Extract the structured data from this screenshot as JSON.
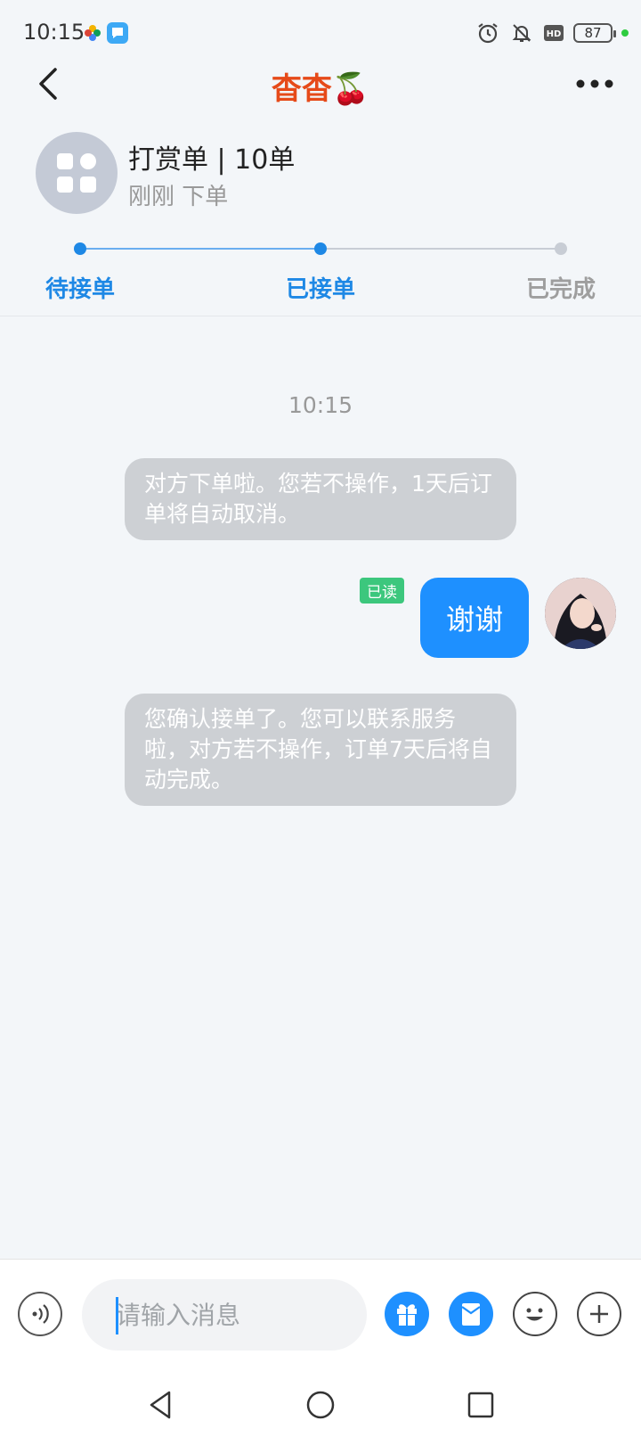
{
  "status_bar": {
    "time": "10:15",
    "battery": "87"
  },
  "header": {
    "title": "杳杳🍒"
  },
  "order": {
    "title": "打赏单 | 10单",
    "subtitle": "刚刚 下单"
  },
  "progress": {
    "steps": [
      {
        "label": "待接单"
      },
      {
        "label": "已接单"
      },
      {
        "label": "已完成"
      }
    ]
  },
  "chat": {
    "timestamp": "10:15",
    "messages": [
      {
        "from": "system",
        "text": "对方下单啦。您若不操作，1天后订单将自动取消。"
      },
      {
        "from": "me",
        "text": "谢谢",
        "status": "已读"
      },
      {
        "from": "system",
        "text": "您确认接单了。您可以联系服务啦，对方若不操作，订单7天后将自动完成。"
      }
    ]
  },
  "input": {
    "placeholder": "请输入消息"
  },
  "colors": {
    "accent": "#1e90ff",
    "title": "#e64a19",
    "step_active": "#1e88e5",
    "step_pending": "#9e9e9e",
    "read_badge": "#3cc77d"
  }
}
